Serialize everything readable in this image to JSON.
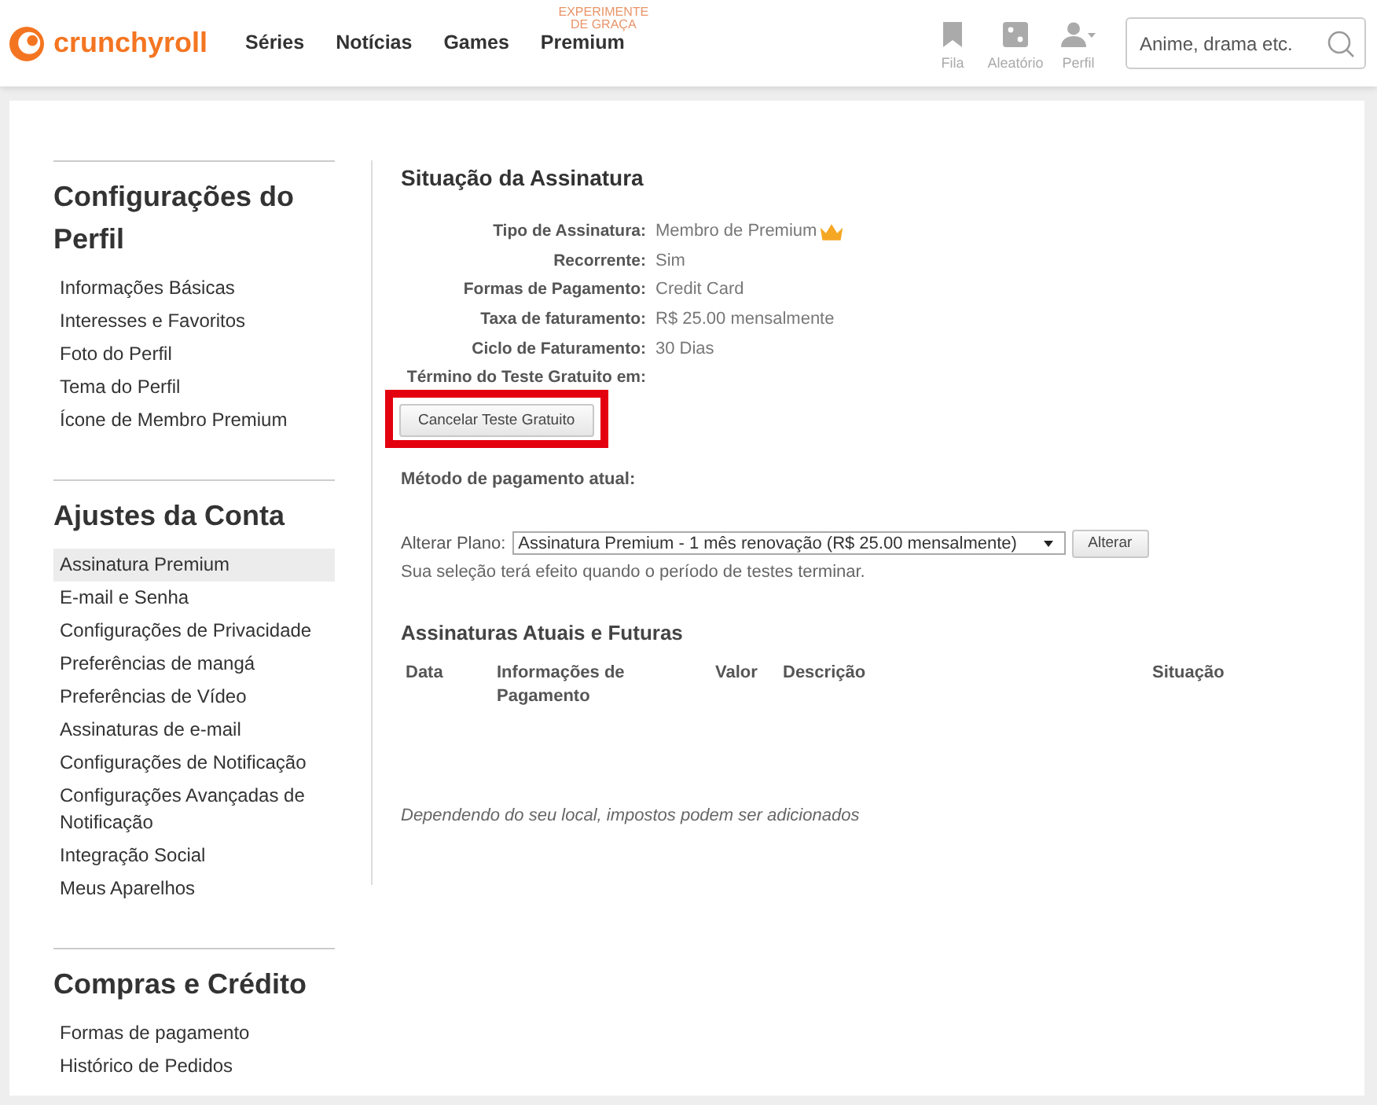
{
  "header": {
    "logo": {
      "text": "crunchyroll"
    },
    "nav": [
      {
        "label": "Séries"
      },
      {
        "label": "Notícias"
      },
      {
        "label": "Games"
      },
      {
        "label": "Premium",
        "badge": "EXPERIMENTE DE GRAÇA"
      }
    ],
    "actions": [
      {
        "kind": "bookmark",
        "label": "Fila"
      },
      {
        "kind": "dice",
        "label": "Aleatório"
      },
      {
        "kind": "person",
        "label": "Perfil"
      }
    ],
    "search": {
      "placeholder": "Anime, drama etc."
    }
  },
  "sidebar": {
    "sections": [
      {
        "title": "Configurações do Perfil",
        "items": [
          {
            "label": "Informações Básicas",
            "selected": false
          },
          {
            "label": "Interesses e Favoritos",
            "selected": false
          },
          {
            "label": "Foto do Perfil",
            "selected": false
          },
          {
            "label": "Tema do Perfil",
            "selected": false
          },
          {
            "label": "Ícone de Membro Premium",
            "selected": false
          }
        ]
      },
      {
        "title": "Ajustes da Conta",
        "items": [
          {
            "label": "Assinatura Premium",
            "selected": true
          },
          {
            "label": "E-mail e Senha",
            "selected": false
          },
          {
            "label": "Configurações de Privacidade",
            "selected": false
          },
          {
            "label": "Preferências de mangá",
            "selected": false
          },
          {
            "label": "Preferências de Vídeo",
            "selected": false
          },
          {
            "label": "Assinaturas de e-mail",
            "selected": false
          },
          {
            "label": "Configurações de Notificação",
            "selected": false
          },
          {
            "label": "Configurações Avançadas de Notificação",
            "selected": false
          },
          {
            "label": "Integração Social",
            "selected": false
          },
          {
            "label": "Meus Aparelhos",
            "selected": false
          }
        ]
      },
      {
        "title": "Compras e Crédito",
        "items": [
          {
            "label": "Formas de pagamento",
            "selected": false
          },
          {
            "label": "Histórico de Pedidos",
            "selected": false
          }
        ]
      }
    ]
  },
  "subscription": {
    "title": "Situação da Assinatura",
    "details": [
      {
        "label": "Tipo de Assinatura:",
        "value": "Membro de Premium",
        "crown": true
      },
      {
        "label": "Recorrente:",
        "value": "Sim",
        "crown": false
      },
      {
        "label": "Formas de Pagamento:",
        "value": "Credit Card",
        "crown": false
      },
      {
        "label": "Taxa de faturamento:",
        "value": "R$ 25.00 mensalmente",
        "crown": false
      },
      {
        "label": "Ciclo de Faturamento:",
        "value": "30 Dias",
        "crown": false
      },
      {
        "label": "Término do Teste Gratuito em:",
        "crown": false
      }
    ],
    "cancel_button": {
      "label": "Cancelar Teste Gratuito",
      "highlighted": true
    }
  },
  "payment_method": {
    "label": "Método de pagamento atual:"
  },
  "plan": {
    "label": "Alterar Plano:",
    "value": "Assinatura Premium - 1 mês renovação (R$ 25.00 mensalmente)",
    "button": "Alterar",
    "note": "Sua seleção terá efeito quando o período de testes terminar."
  },
  "history": {
    "title": "Assinaturas Atuais e Futuras",
    "columns": [
      "Data",
      "Informações de Pagamento",
      "Valor",
      "Descrição",
      "Situação"
    ]
  },
  "footnote": "Dependendo do seu local, impostos podem ser adicionados"
}
